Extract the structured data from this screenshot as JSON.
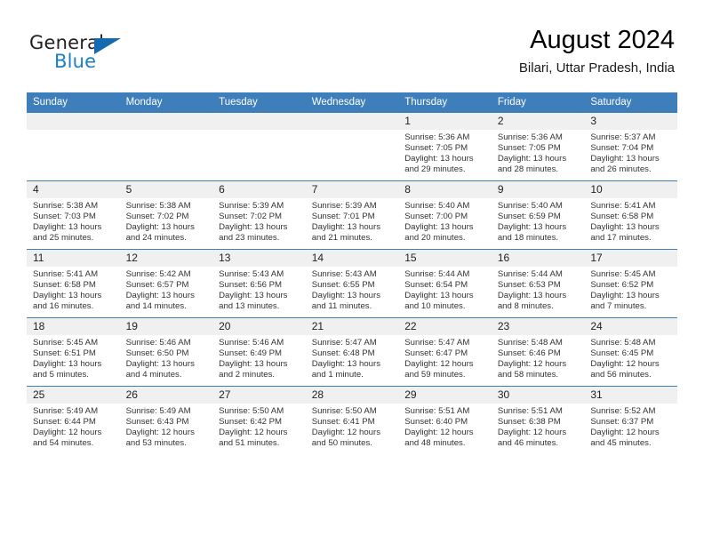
{
  "brand": {
    "name_part1": "General",
    "name_part2": "Blue",
    "triangle_icon": "blue-triangle-logo-mark"
  },
  "header": {
    "title": "August 2024",
    "subtitle": "Bilari, Uttar Pradesh, India"
  },
  "colors": {
    "header_blue": "#3D7EBB",
    "logo_blue": "#1C7FC4",
    "day_band": "#F0F0F0"
  },
  "weekday_headers": [
    "Sunday",
    "Monday",
    "Tuesday",
    "Wednesday",
    "Thursday",
    "Friday",
    "Saturday"
  ],
  "labels": {
    "sunrise": "Sunrise:",
    "sunset": "Sunset:",
    "daylight": "Daylight:"
  },
  "weeks": [
    [
      {
        "day": "",
        "empty": true
      },
      {
        "day": "",
        "empty": true
      },
      {
        "day": "",
        "empty": true
      },
      {
        "day": "",
        "empty": true
      },
      {
        "day": "1",
        "sunrise": "Sunrise: 5:36 AM",
        "sunset": "Sunset: 7:05 PM",
        "daylight1": "Daylight: 13 hours",
        "daylight2": "and 29 minutes."
      },
      {
        "day": "2",
        "sunrise": "Sunrise: 5:36 AM",
        "sunset": "Sunset: 7:05 PM",
        "daylight1": "Daylight: 13 hours",
        "daylight2": "and 28 minutes."
      },
      {
        "day": "3",
        "sunrise": "Sunrise: 5:37 AM",
        "sunset": "Sunset: 7:04 PM",
        "daylight1": "Daylight: 13 hours",
        "daylight2": "and 26 minutes."
      }
    ],
    [
      {
        "day": "4",
        "sunrise": "Sunrise: 5:38 AM",
        "sunset": "Sunset: 7:03 PM",
        "daylight1": "Daylight: 13 hours",
        "daylight2": "and 25 minutes."
      },
      {
        "day": "5",
        "sunrise": "Sunrise: 5:38 AM",
        "sunset": "Sunset: 7:02 PM",
        "daylight1": "Daylight: 13 hours",
        "daylight2": "and 24 minutes."
      },
      {
        "day": "6",
        "sunrise": "Sunrise: 5:39 AM",
        "sunset": "Sunset: 7:02 PM",
        "daylight1": "Daylight: 13 hours",
        "daylight2": "and 23 minutes."
      },
      {
        "day": "7",
        "sunrise": "Sunrise: 5:39 AM",
        "sunset": "Sunset: 7:01 PM",
        "daylight1": "Daylight: 13 hours",
        "daylight2": "and 21 minutes."
      },
      {
        "day": "8",
        "sunrise": "Sunrise: 5:40 AM",
        "sunset": "Sunset: 7:00 PM",
        "daylight1": "Daylight: 13 hours",
        "daylight2": "and 20 minutes."
      },
      {
        "day": "9",
        "sunrise": "Sunrise: 5:40 AM",
        "sunset": "Sunset: 6:59 PM",
        "daylight1": "Daylight: 13 hours",
        "daylight2": "and 18 minutes."
      },
      {
        "day": "10",
        "sunrise": "Sunrise: 5:41 AM",
        "sunset": "Sunset: 6:58 PM",
        "daylight1": "Daylight: 13 hours",
        "daylight2": "and 17 minutes."
      }
    ],
    [
      {
        "day": "11",
        "sunrise": "Sunrise: 5:41 AM",
        "sunset": "Sunset: 6:58 PM",
        "daylight1": "Daylight: 13 hours",
        "daylight2": "and 16 minutes."
      },
      {
        "day": "12",
        "sunrise": "Sunrise: 5:42 AM",
        "sunset": "Sunset: 6:57 PM",
        "daylight1": "Daylight: 13 hours",
        "daylight2": "and 14 minutes."
      },
      {
        "day": "13",
        "sunrise": "Sunrise: 5:43 AM",
        "sunset": "Sunset: 6:56 PM",
        "daylight1": "Daylight: 13 hours",
        "daylight2": "and 13 minutes."
      },
      {
        "day": "14",
        "sunrise": "Sunrise: 5:43 AM",
        "sunset": "Sunset: 6:55 PM",
        "daylight1": "Daylight: 13 hours",
        "daylight2": "and 11 minutes."
      },
      {
        "day": "15",
        "sunrise": "Sunrise: 5:44 AM",
        "sunset": "Sunset: 6:54 PM",
        "daylight1": "Daylight: 13 hours",
        "daylight2": "and 10 minutes."
      },
      {
        "day": "16",
        "sunrise": "Sunrise: 5:44 AM",
        "sunset": "Sunset: 6:53 PM",
        "daylight1": "Daylight: 13 hours",
        "daylight2": "and 8 minutes."
      },
      {
        "day": "17",
        "sunrise": "Sunrise: 5:45 AM",
        "sunset": "Sunset: 6:52 PM",
        "daylight1": "Daylight: 13 hours",
        "daylight2": "and 7 minutes."
      }
    ],
    [
      {
        "day": "18",
        "sunrise": "Sunrise: 5:45 AM",
        "sunset": "Sunset: 6:51 PM",
        "daylight1": "Daylight: 13 hours",
        "daylight2": "and 5 minutes."
      },
      {
        "day": "19",
        "sunrise": "Sunrise: 5:46 AM",
        "sunset": "Sunset: 6:50 PM",
        "daylight1": "Daylight: 13 hours",
        "daylight2": "and 4 minutes."
      },
      {
        "day": "20",
        "sunrise": "Sunrise: 5:46 AM",
        "sunset": "Sunset: 6:49 PM",
        "daylight1": "Daylight: 13 hours",
        "daylight2": "and 2 minutes."
      },
      {
        "day": "21",
        "sunrise": "Sunrise: 5:47 AM",
        "sunset": "Sunset: 6:48 PM",
        "daylight1": "Daylight: 13 hours",
        "daylight2": "and 1 minute."
      },
      {
        "day": "22",
        "sunrise": "Sunrise: 5:47 AM",
        "sunset": "Sunset: 6:47 PM",
        "daylight1": "Daylight: 12 hours",
        "daylight2": "and 59 minutes."
      },
      {
        "day": "23",
        "sunrise": "Sunrise: 5:48 AM",
        "sunset": "Sunset: 6:46 PM",
        "daylight1": "Daylight: 12 hours",
        "daylight2": "and 58 minutes."
      },
      {
        "day": "24",
        "sunrise": "Sunrise: 5:48 AM",
        "sunset": "Sunset: 6:45 PM",
        "daylight1": "Daylight: 12 hours",
        "daylight2": "and 56 minutes."
      }
    ],
    [
      {
        "day": "25",
        "sunrise": "Sunrise: 5:49 AM",
        "sunset": "Sunset: 6:44 PM",
        "daylight1": "Daylight: 12 hours",
        "daylight2": "and 54 minutes."
      },
      {
        "day": "26",
        "sunrise": "Sunrise: 5:49 AM",
        "sunset": "Sunset: 6:43 PM",
        "daylight1": "Daylight: 12 hours",
        "daylight2": "and 53 minutes."
      },
      {
        "day": "27",
        "sunrise": "Sunrise: 5:50 AM",
        "sunset": "Sunset: 6:42 PM",
        "daylight1": "Daylight: 12 hours",
        "daylight2": "and 51 minutes."
      },
      {
        "day": "28",
        "sunrise": "Sunrise: 5:50 AM",
        "sunset": "Sunset: 6:41 PM",
        "daylight1": "Daylight: 12 hours",
        "daylight2": "and 50 minutes."
      },
      {
        "day": "29",
        "sunrise": "Sunrise: 5:51 AM",
        "sunset": "Sunset: 6:40 PM",
        "daylight1": "Daylight: 12 hours",
        "daylight2": "and 48 minutes."
      },
      {
        "day": "30",
        "sunrise": "Sunrise: 5:51 AM",
        "sunset": "Sunset: 6:38 PM",
        "daylight1": "Daylight: 12 hours",
        "daylight2": "and 46 minutes."
      },
      {
        "day": "31",
        "sunrise": "Sunrise: 5:52 AM",
        "sunset": "Sunset: 6:37 PM",
        "daylight1": "Daylight: 12 hours",
        "daylight2": "and 45 minutes."
      }
    ]
  ]
}
